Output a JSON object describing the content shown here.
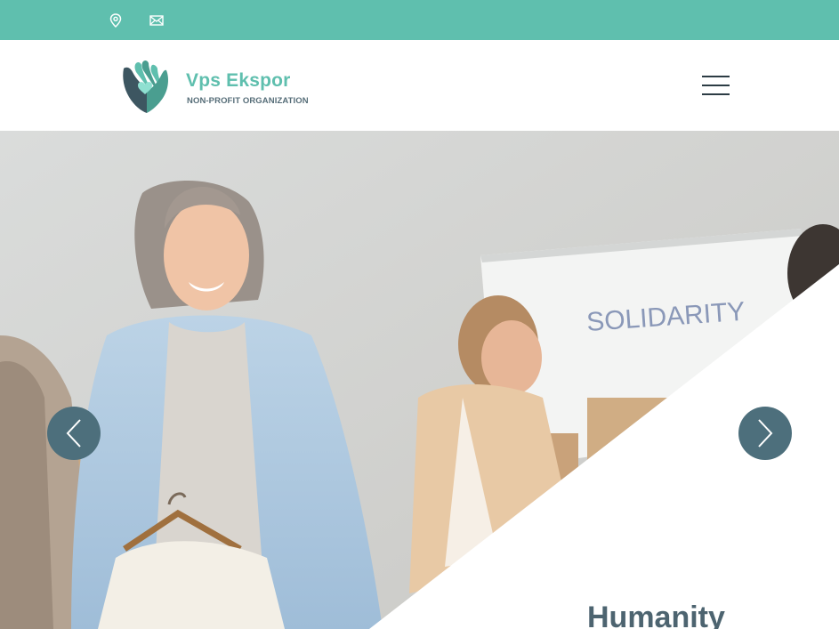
{
  "topbar": {
    "background": "#5fbfae",
    "icons": [
      "location-pin-icon",
      "envelope-icon"
    ]
  },
  "header": {
    "brand_name": "Vps Ekspor",
    "brand_tagline": "NON-PROFIT ORGANIZATION",
    "menu_icon": "hamburger-menu-icon"
  },
  "hero": {
    "headline": "Humanity",
    "image_description_text": "SOLIDARITY",
    "prev_icon": "chevron-left-icon",
    "next_icon": "chevron-right-icon"
  },
  "colors": {
    "accent": "#5fbfae",
    "dark": "#4d6470",
    "arrow_bg": "#4d6f7c"
  }
}
